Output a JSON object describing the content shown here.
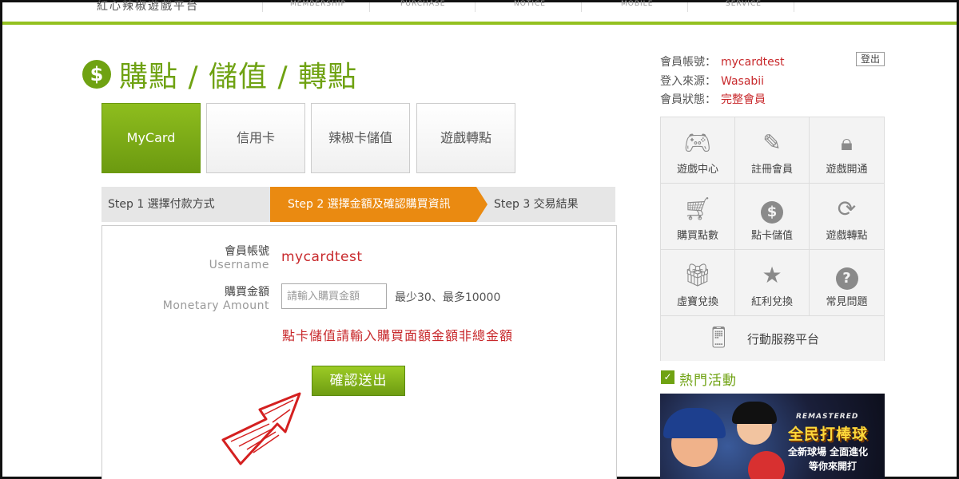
{
  "nav": {
    "brand": "紅心辣椒遊戲平台",
    "items": [
      "MEMBERSHIP",
      "PURCHASE",
      "NOTICE",
      "MOBILE",
      "SERVICE"
    ]
  },
  "header": {
    "icon": "dollar-icon",
    "title": "購點 / 儲值 / 轉點"
  },
  "tabs": [
    {
      "label": "MyCard",
      "active": true
    },
    {
      "label": "信用卡",
      "active": false
    },
    {
      "label": "辣椒卡儲值",
      "active": false
    },
    {
      "label": "遊戲轉點",
      "active": false
    }
  ],
  "steps": [
    {
      "label": "Step 1 選擇付款方式",
      "active": false
    },
    {
      "label": "Step 2 選擇金額及確認購買資訊",
      "active": true
    },
    {
      "label": "Step 3 交易結果",
      "active": false
    }
  ],
  "form": {
    "username_label_zh": "會員帳號",
    "username_label_en": "Username",
    "username_value": "mycardtest",
    "amount_label_zh": "購買金額",
    "amount_label_en": "Monetary Amount",
    "amount_placeholder": "請輸入購買金額",
    "amount_value": "",
    "amount_limit": "最少30、最多10000",
    "warning": "點卡儲值請輸入購買面額金額非總金額",
    "submit_label": "確認送出"
  },
  "member": {
    "account_label": "會員帳號：",
    "account_value": "mycardtest",
    "source_label": "登入來源：",
    "source_value": "Wasabii",
    "status_label": "會員狀態：",
    "status_value": "完整會員",
    "logout_label": "登出"
  },
  "services": [
    {
      "label": "遊戲中心",
      "icon": "gamepad-icon"
    },
    {
      "label": "註冊會員",
      "icon": "register-icon"
    },
    {
      "label": "遊戲開通",
      "icon": "lock-icon"
    },
    {
      "label": "購買點數",
      "icon": "cart-icon"
    },
    {
      "label": "點卡儲值",
      "icon": "coin-icon"
    },
    {
      "label": "遊戲轉點",
      "icon": "refresh-icon"
    },
    {
      "label": "虛寶兌換",
      "icon": "gift-icon"
    },
    {
      "label": "紅利兌換",
      "icon": "star-icon"
    },
    {
      "label": "常見問題",
      "icon": "question-icon"
    }
  ],
  "mobile_service": {
    "label": "行動服務平台",
    "icon": "mobile-icon"
  },
  "hot": {
    "title": "熱門活動",
    "banner_tag": "REMASTERED",
    "banner_title": "全民打棒球",
    "banner_sub1": "全新球場 全面進化",
    "banner_sub2": "等你來開打"
  },
  "colors": {
    "brand_green": "#6fa212",
    "accent_orange": "#ea8a11",
    "accent_red": "#c8292c"
  }
}
